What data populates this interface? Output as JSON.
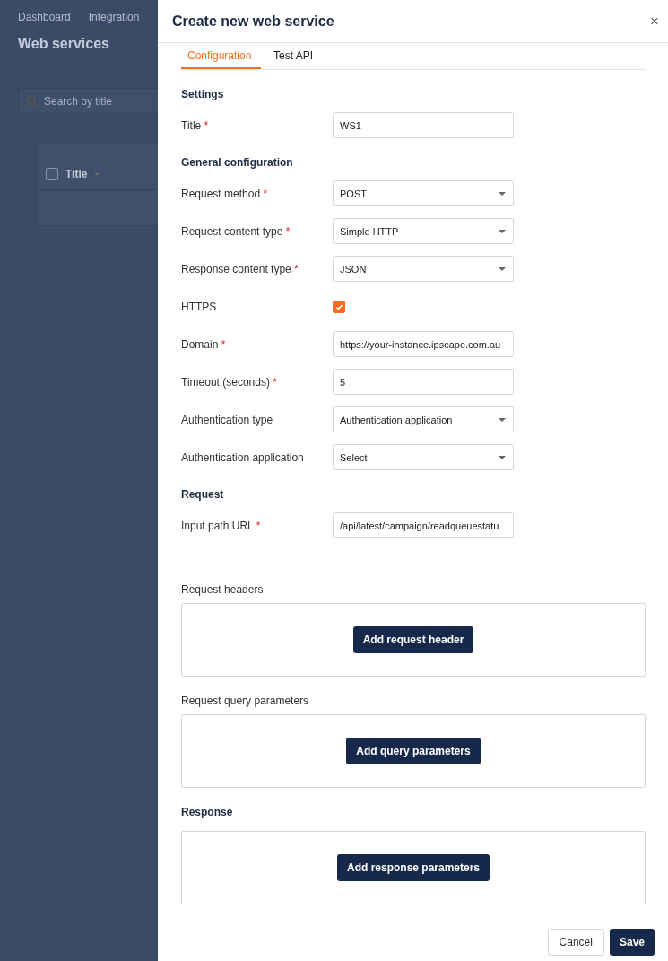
{
  "background": {
    "breadcrumb": [
      "Dashboard",
      "Integration"
    ],
    "page_title": "Web services",
    "search": {
      "placeholder": "Search by title"
    },
    "table": {
      "select_all": {
        "checked": false
      },
      "columns": [
        "Title"
      ]
    }
  },
  "required_mark": "*",
  "drawer": {
    "title": "Create new web service",
    "close": "×",
    "tabs": [
      {
        "label": "Configuration",
        "selected": true
      },
      {
        "label": "Test API",
        "selected": false
      }
    ],
    "sections": [
      {
        "heading": "Settings",
        "fields": [
          {
            "kind": "text",
            "label": "Title",
            "required": true,
            "value": "WS1"
          }
        ]
      },
      {
        "heading": "General configuration",
        "fields": [
          {
            "kind": "select",
            "label": "Request method",
            "required": true,
            "value": "POST"
          },
          {
            "kind": "select",
            "label": "Request content type",
            "required": true,
            "value": "Simple HTTP"
          },
          {
            "kind": "select",
            "label": "Response content type",
            "required": true,
            "value": "JSON"
          },
          {
            "kind": "checkbox",
            "label": "HTTPS",
            "required": false,
            "checked": true
          },
          {
            "kind": "text",
            "label": "Domain",
            "required": true,
            "value": "https://your-instance.ipscape.com.au"
          },
          {
            "kind": "text",
            "label": "Timeout (seconds)",
            "required": true,
            "value": "5"
          },
          {
            "kind": "select",
            "label": "Authentication type",
            "required": false,
            "value": "Authentication application"
          },
          {
            "kind": "select",
            "label": "Authentication application",
            "required": false,
            "value": "Select"
          }
        ]
      },
      {
        "heading": "Request",
        "fields": [
          {
            "kind": "text",
            "label": "Input path URL",
            "required": true,
            "value": "/api/latest/campaign/readqueuestatu"
          }
        ]
      }
    ],
    "param_boxes": [
      {
        "kind": "label",
        "title": "Request headers",
        "button": "Add request header"
      },
      {
        "kind": "label",
        "title": "Request query parameters",
        "button": "Add query parameters"
      },
      {
        "kind": "heading",
        "title": "Response",
        "button": "Add response parameters"
      }
    ],
    "footer": {
      "buttons": [
        {
          "kind": "secondary",
          "label": "Cancel"
        },
        {
          "kind": "primary",
          "label": "Save"
        }
      ]
    }
  }
}
